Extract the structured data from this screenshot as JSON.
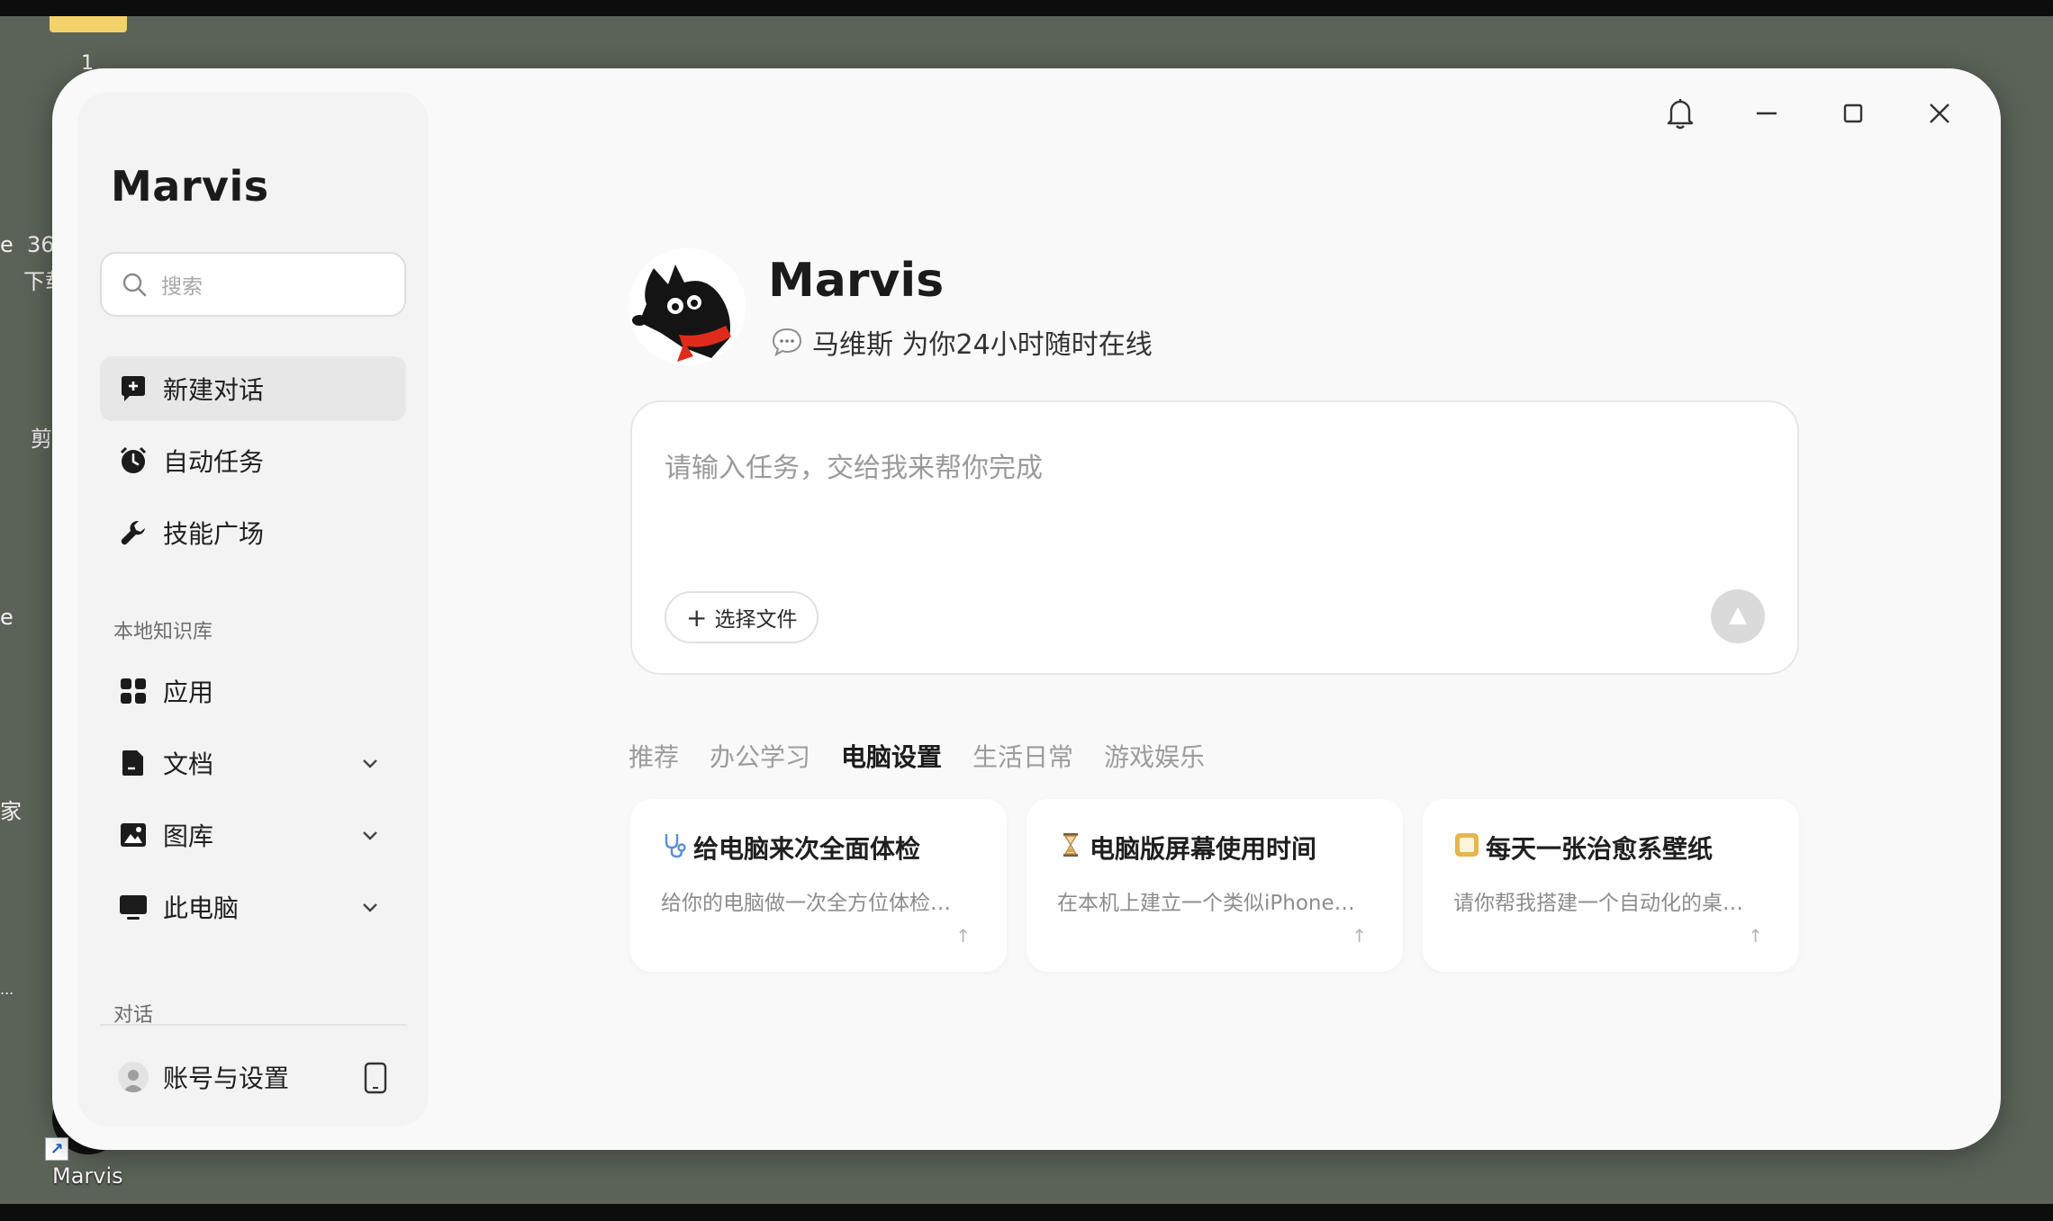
{
  "desktop": {
    "folder_number": "1",
    "fragments": [
      "e",
      "36",
      "下载",
      "剪",
      "e",
      "家",
      "..."
    ],
    "shortcut_label": "Marvis"
  },
  "window_controls": {
    "bell": "bell-icon",
    "minimize": "minimize-icon",
    "maximize": "maximize-icon",
    "close": "close-icon"
  },
  "sidebar": {
    "brand": "Marvis",
    "search_placeholder": "搜索",
    "items": [
      {
        "label": "新建对话",
        "icon": "new-chat-icon"
      },
      {
        "label": "自动任务",
        "icon": "alarm-clock-icon"
      },
      {
        "label": "技能广场",
        "icon": "wrench-icon"
      }
    ],
    "knowledge_label": "本地知识库",
    "knowledge_items": [
      {
        "label": "应用",
        "icon": "grid-icon"
      },
      {
        "label": "文档",
        "icon": "document-icon"
      },
      {
        "label": "图库",
        "icon": "image-icon"
      },
      {
        "label": "此电脑",
        "icon": "monitor-icon"
      }
    ],
    "conversations_label": "对话",
    "account_label": "账号与设置"
  },
  "hero": {
    "title": "Marvis",
    "subtitle": "马维斯 为你24小时随时在线"
  },
  "composer": {
    "placeholder": "请输入任务，交给我来帮你完成",
    "file_button": "选择文件",
    "plus": "+"
  },
  "tabs": [
    "推荐",
    "办公学习",
    "电脑设置",
    "生活日常",
    "游戏娱乐"
  ],
  "active_tab": "电脑设置",
  "cards": [
    {
      "title": "给电脑来次全面体检",
      "desc": "给你的电脑做一次全方位体检…",
      "icon": "stethoscope-icon"
    },
    {
      "title": "电脑版屏幕使用时间",
      "desc": "在本机上建立一个类似iPhone…",
      "icon": "hourglass-icon"
    },
    {
      "title": "每天一张治愈系壁纸",
      "desc": "请你帮我搭建一个自动化的桌…",
      "icon": "picture-frame-icon"
    }
  ],
  "card_arrow": "↑",
  "colors": {
    "desktop_bg": "#5b6358",
    "window_bg": "#f9f9f9",
    "sidebar_bg": "#f3f3f3",
    "accent_red": "#e02b1c"
  }
}
